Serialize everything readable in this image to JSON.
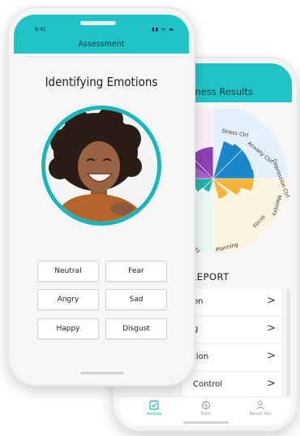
{
  "back_screen": {
    "header_title": "n Fitness Results",
    "chart_labels": [
      "Stress Ctrl",
      "Anxiety Ctrl",
      "Depression Ctrl",
      "Memory",
      "Focus",
      "Planning",
      "ty"
    ],
    "report_title": ". REPORT",
    "report_items": [
      {
        "label": "on"
      },
      {
        "label": "g"
      },
      {
        "label": "tion"
      },
      {
        "label": "Control"
      }
    ],
    "chevron": ">",
    "tabs": [
      {
        "label": "Assess",
        "icon": "check-square-icon",
        "active": true
      },
      {
        "label": "Train",
        "icon": "brain-icon",
        "active": false
      },
      {
        "label": "About You",
        "icon": "person-icon",
        "active": false
      }
    ]
  },
  "front_screen": {
    "status_time": "9:41",
    "status_icons": "▮▮ ᯤ ▬",
    "header_title": "Assessment",
    "page_title": "Identifying Emotions",
    "options": [
      "Neutral",
      "Fear",
      "Angry",
      "Sad",
      "Happy",
      "Disgust"
    ]
  },
  "colors": {
    "accent": "#20c4c7",
    "ring": "#16b8bb"
  }
}
